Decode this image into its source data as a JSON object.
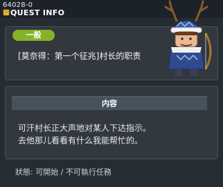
{
  "window": {
    "quest_id": "64028-0",
    "title": "QUEST INFO",
    "title_icon": "quest-scroll-icon"
  },
  "quest": {
    "category_badge": "一般",
    "name": "[莫奈得：第一个征兆]村长的职责"
  },
  "content": {
    "header": "内容",
    "lines": [
      "可汗村长正大声地对某人下达指示。",
      "去他那儿看看有什么我能帮忙的。"
    ]
  },
  "status": {
    "text": "狀態: 可開始 / 不可執行任務"
  },
  "npc": {
    "icon": "npc-antlered-hunter-portrait"
  },
  "colors": {
    "window_bg": "#252d33",
    "panel_bg": "#32383e",
    "badge_green": "#86b22a",
    "header_bg": "#46535c"
  }
}
